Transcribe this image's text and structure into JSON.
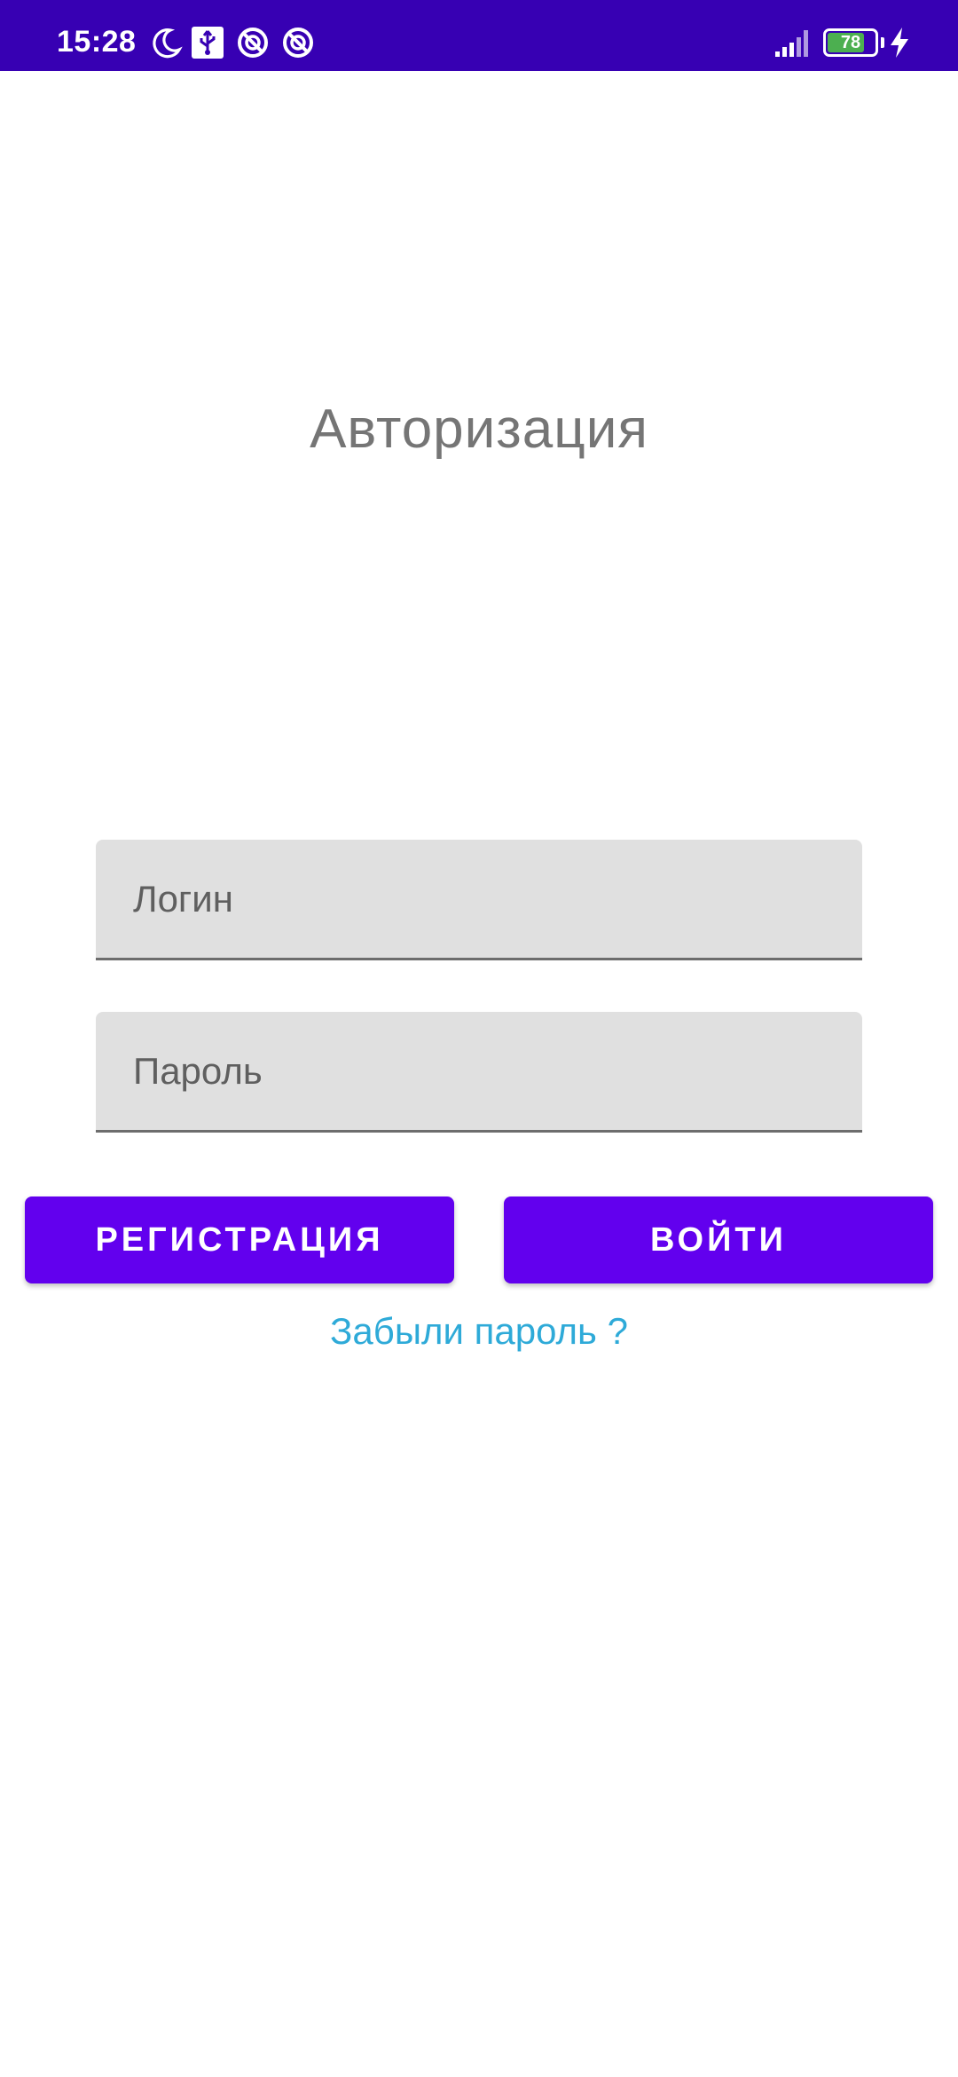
{
  "status_bar": {
    "time": "15:28",
    "battery_level": "78",
    "battery_fraction": 0.78,
    "background_color": "#3700b3",
    "icons": [
      "moon-icon",
      "usb-icon",
      "no-disturb-icon",
      "no-disturb-icon",
      "signal-icon",
      "battery-icon",
      "charging-icon"
    ]
  },
  "screen": {
    "title": "Авторизация"
  },
  "form": {
    "login_placeholder": "Логин",
    "password_placeholder": "Пароль",
    "register_label": "РЕГИСТРАЦИЯ",
    "login_label": "ВОЙТИ",
    "forgot_label": "Забыли пароль ?",
    "button_color": "#6200ee",
    "link_color": "#2eaad8"
  }
}
